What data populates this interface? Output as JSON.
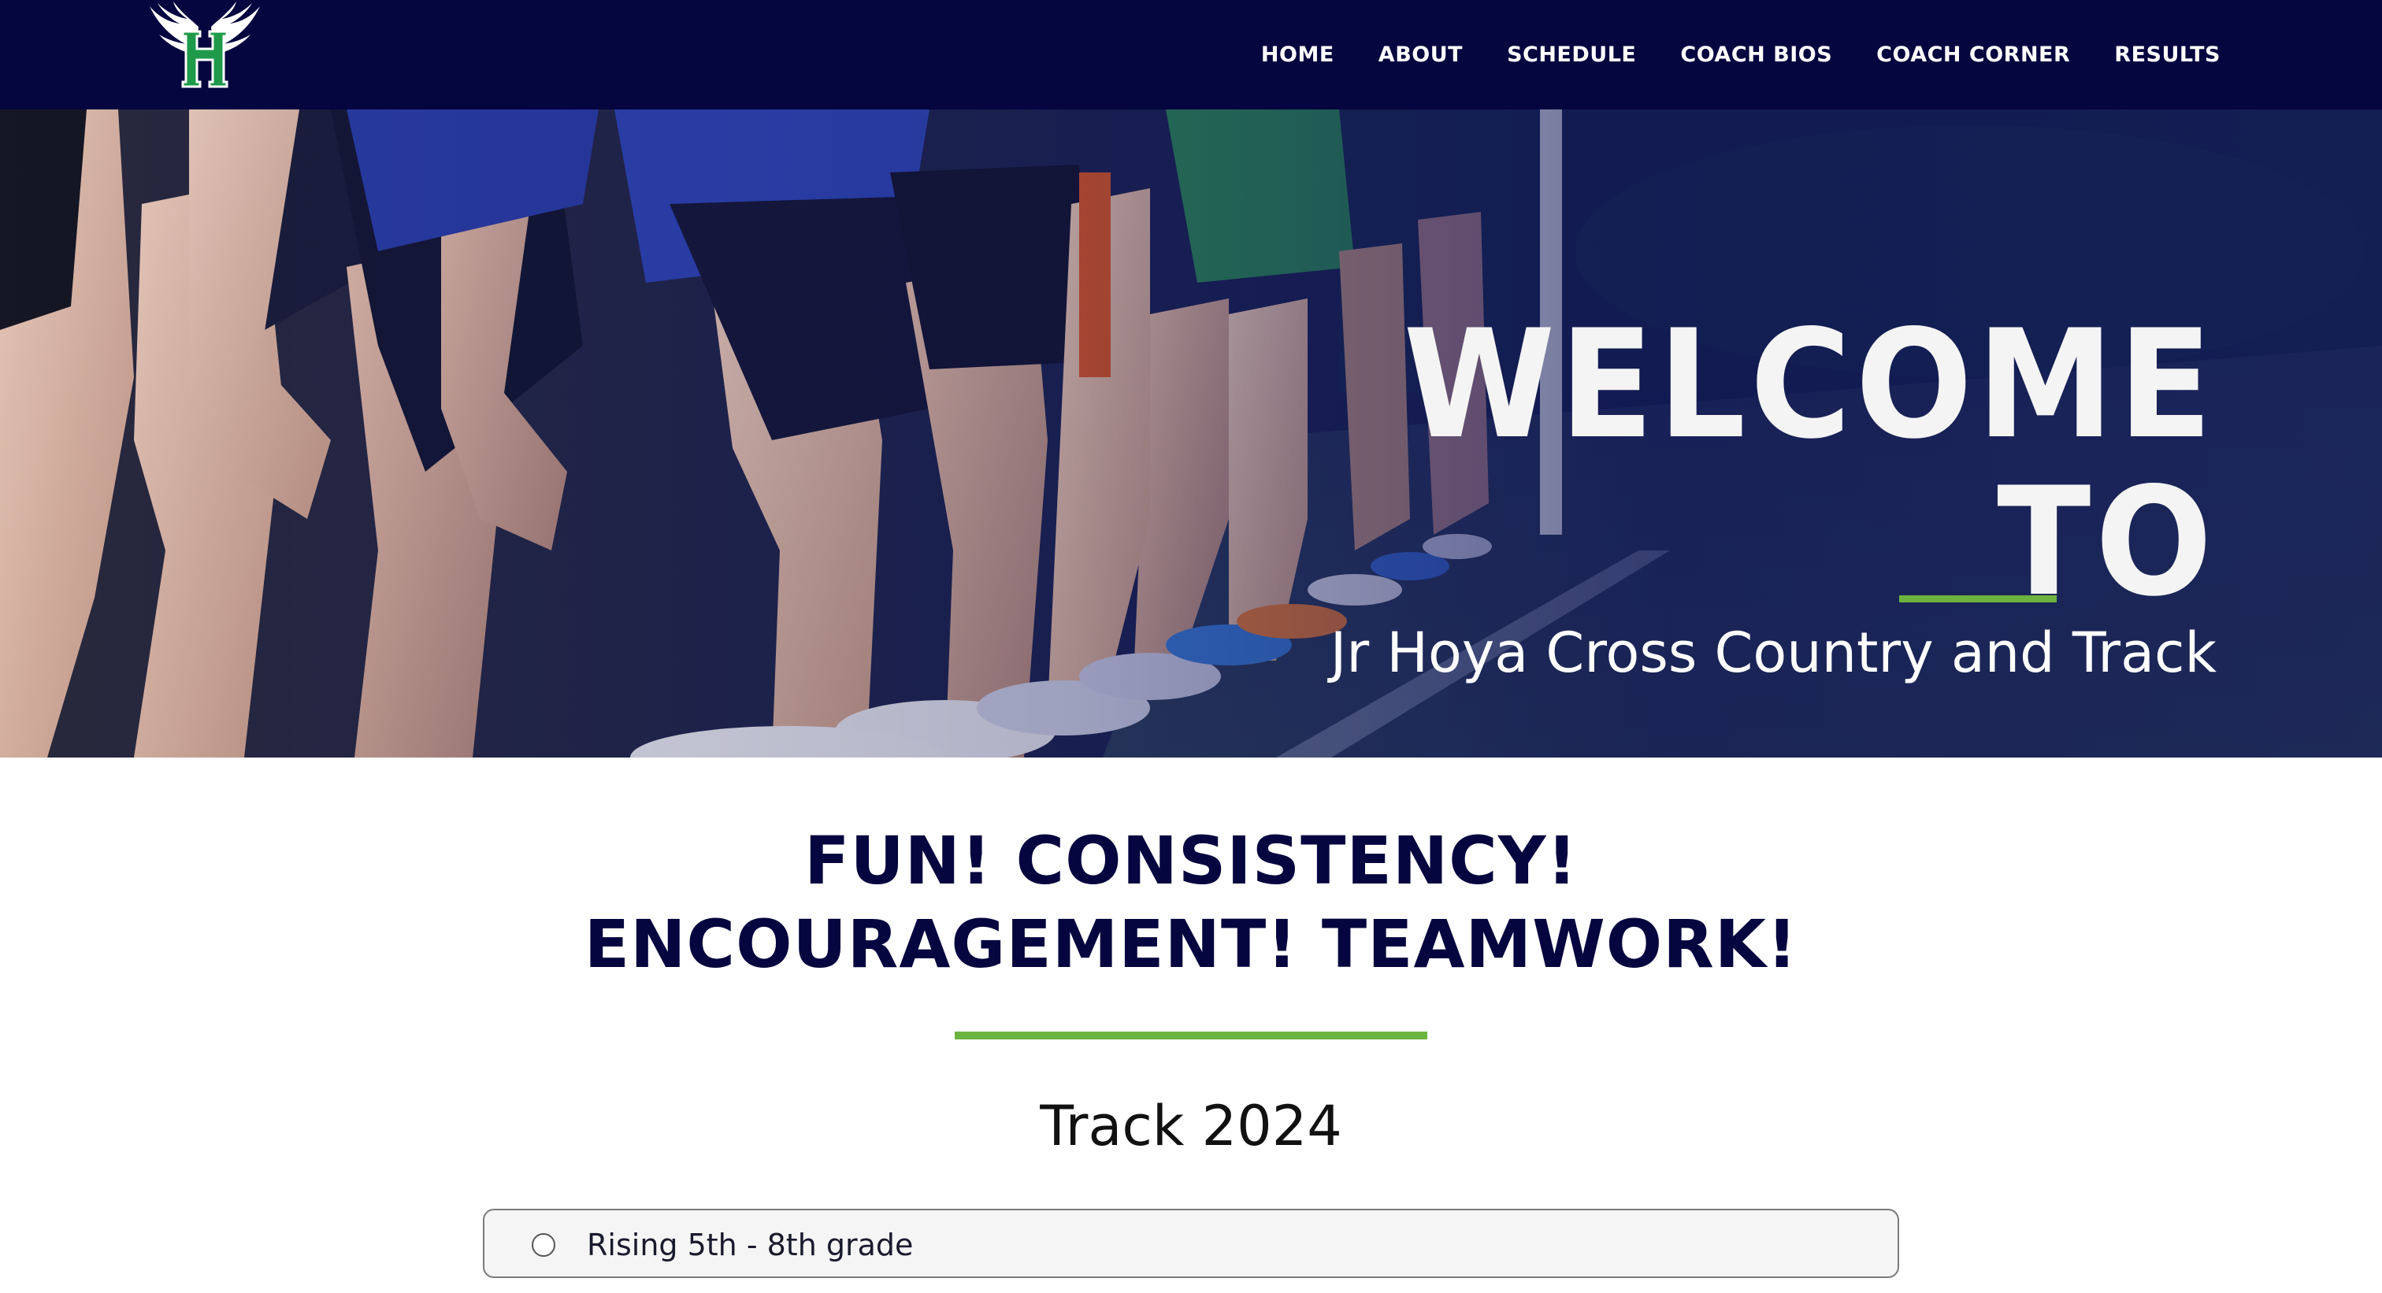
{
  "nav": {
    "logo_letter": "H",
    "items": [
      {
        "label": "HOME"
      },
      {
        "label": "ABOUT"
      },
      {
        "label": "SCHEDULE"
      },
      {
        "label": "COACH BIOS"
      },
      {
        "label": "COACH CORNER"
      },
      {
        "label": "RESULTS"
      }
    ]
  },
  "hero": {
    "title": "WELCOME TO",
    "subtitle": "Jr Hoya Cross Country and Track"
  },
  "main": {
    "tagline_line1": "FUN! CONSISTENCY!",
    "tagline_line2": "ENCOURAGEMENT! TEAMWORK!",
    "section_title": "Track 2024",
    "options": [
      {
        "label": "Rising 5th - 8th grade",
        "selected": false
      }
    ]
  },
  "colors": {
    "navy": "#05053f",
    "accent_green": "#6db33f",
    "white": "#ffffff"
  },
  "icons": {
    "logo": "winged-h-logo-icon",
    "radio": "radio-unchecked-icon"
  }
}
